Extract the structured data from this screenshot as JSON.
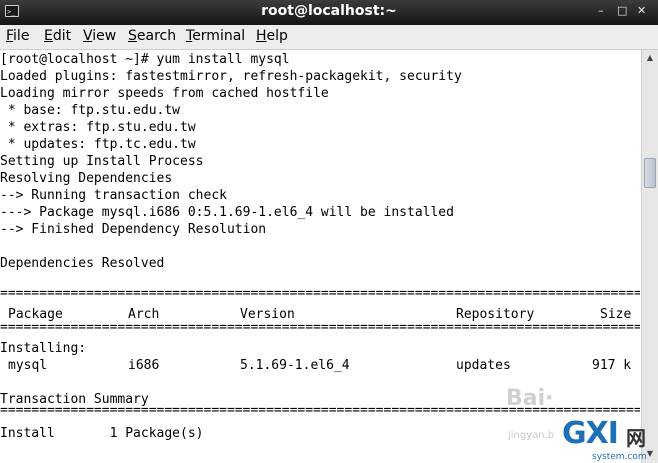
{
  "window": {
    "title": "root@localhost:~",
    "controls": {
      "minimize": "–",
      "maximize": "□",
      "close": "✕"
    },
    "app_icon_glyph": ">_"
  },
  "menu": {
    "items": [
      {
        "mnemonic": "F",
        "rest": "ile"
      },
      {
        "mnemonic": "E",
        "rest": "dit"
      },
      {
        "mnemonic": "V",
        "rest": "iew"
      },
      {
        "mnemonic": "S",
        "rest": "earch"
      },
      {
        "mnemonic": "T",
        "rest": "erminal"
      },
      {
        "mnemonic": "H",
        "rest": "elp"
      }
    ]
  },
  "terminal": {
    "lines": [
      "[root@localhost ~]# yum install mysql",
      "Loaded plugins: fastestmirror, refresh-packagekit, security",
      "Loading mirror speeds from cached hostfile",
      " * base: ftp.stu.edu.tw",
      " * extras: ftp.stu.edu.tw",
      " * updates: ftp.tc.edu.tw",
      "Setting up Install Process",
      "Resolving Dependencies",
      "--> Running transaction check",
      "---> Package mysql.i686 0:5.1.69-1.el6_4 will be installed",
      "--> Finished Dependency Resolution",
      "",
      "Dependencies Resolved"
    ],
    "table": {
      "headers": {
        "package": "Package",
        "arch": "Arch",
        "version": "Version",
        "repository": "Repository",
        "size": "Size"
      },
      "section_label": "Installing:",
      "row": {
        "package": "mysql",
        "arch": "i686",
        "version": "5.1.69-1.el6_4",
        "repository": "updates",
        "size": "917 k"
      }
    },
    "summary_title": "Transaction Summary",
    "summary_line": "Install       1 Package(s)"
  },
  "scrollbar": {
    "up_arrow": "▲",
    "down_arrow": "▼"
  },
  "watermarks": {
    "baidu": "Bai·",
    "jingyan": "jingyan.b",
    "logo_big": "GXI",
    "logo_cn": "网",
    "logo_small": "system.com"
  }
}
